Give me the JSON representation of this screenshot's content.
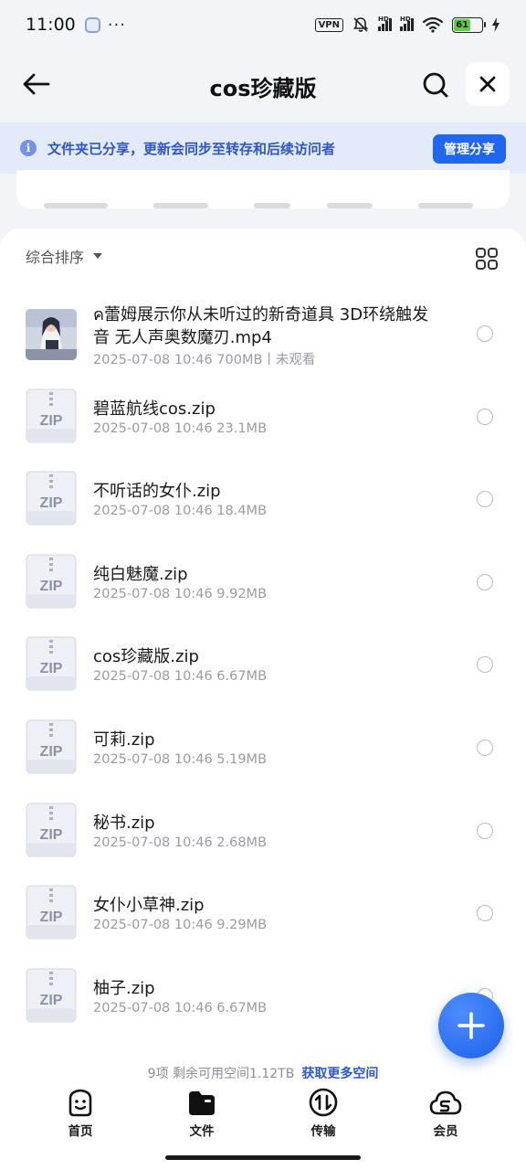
{
  "status_bar": {
    "time": "11:00",
    "dots": "···",
    "vpn": "VPN",
    "hd": "HD",
    "battery": "61"
  },
  "header": {
    "title": "cos珍藏版"
  },
  "notice": {
    "icon": "i",
    "text": "文件夹已分享，更新会同步至转存和后续访问者",
    "button": "管理分享"
  },
  "toolbar": {
    "sort_label": "综合排序"
  },
  "files": [
    {
      "name": "ค蕾姆展示你从未听过的新奇道具 3D环绕触发音 无人声奥数魔刃.mp4",
      "meta": "2025-07-08 10:46  700MB丨未观看",
      "icon": "video-thumbnail"
    },
    {
      "name": "碧蓝航线cos.zip",
      "meta": "2025-07-08 10:46  23.1MB",
      "icon": "zip-file-icon"
    },
    {
      "name": "不听话的女仆.zip",
      "meta": "2025-07-08 10:46  18.4MB",
      "icon": "zip-file-icon"
    },
    {
      "name": "纯白魅魔.zip",
      "meta": "2025-07-08 10:46  9.92MB",
      "icon": "zip-file-icon"
    },
    {
      "name": "cos珍藏版.zip",
      "meta": "2025-07-08 10:46  6.67MB",
      "icon": "zip-file-icon"
    },
    {
      "name": "可莉.zip",
      "meta": "2025-07-08 10:46  5.19MB",
      "icon": "zip-file-icon"
    },
    {
      "name": "秘书.zip",
      "meta": "2025-07-08 10:46  2.68MB",
      "icon": "zip-file-icon"
    },
    {
      "name": "女仆小草神.zip",
      "meta": "2025-07-08 10:46  9.29MB",
      "icon": "zip-file-icon"
    },
    {
      "name": "柚子.zip",
      "meta": "2025-07-08 10:46  6.67MB",
      "icon": "zip-file-icon"
    }
  ],
  "zip_label": "ZIP",
  "footer": {
    "info": "9项 剩余可用空间1.12TB",
    "link": "获取更多空间"
  },
  "tabbar": {
    "tabs": [
      {
        "label": "首页",
        "icon": "home-smile-icon"
      },
      {
        "label": "文件",
        "icon": "folder-icon"
      },
      {
        "label": "传输",
        "icon": "transfer-icon"
      },
      {
        "label": "会员",
        "icon": "vip-cloud-icon"
      }
    ]
  },
  "colors": {
    "accent": "#1f66f0",
    "notice_bg": "#e3eafa",
    "notice_text": "#2f56c9",
    "page_bg": "#f3f4f8"
  }
}
